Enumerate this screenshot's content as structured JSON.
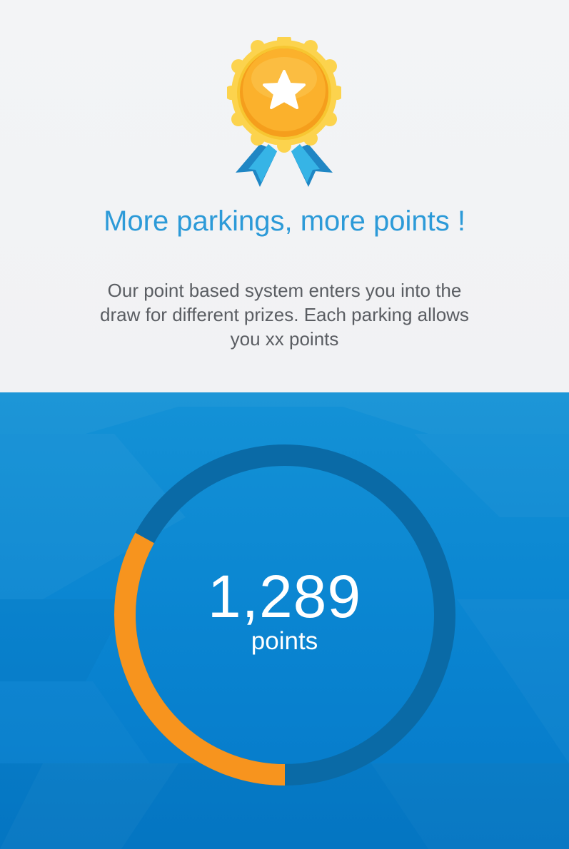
{
  "intro": {
    "headline": "More parkings, more points !",
    "description": "Our point based system enters you into the draw for different prizes. Each parking allows you xx points",
    "badge_icon": "award-ribbon-star-icon"
  },
  "progress": {
    "value": "1,289",
    "unit": "points",
    "fill_fraction": 0.33,
    "fill_color": "#f7941e",
    "track_color": "#0a6aa6"
  },
  "colors": {
    "headline": "#2c9ad8",
    "body_text": "#5a5d62",
    "background_top": "#f2f3f5",
    "background_bottom": "#0a85d1"
  }
}
